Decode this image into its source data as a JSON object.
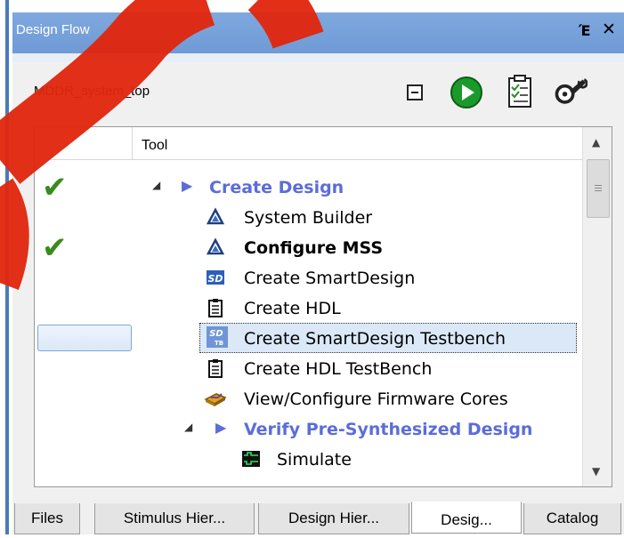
{
  "window": {
    "title": "Design Flow",
    "float_glyph": "Έ",
    "close_glyph": "✕"
  },
  "toolbar": {
    "design_name": "MDDR_system_top",
    "icons": [
      "collapse-icon",
      "run-icon",
      "report-icon",
      "settings-wrench-icon"
    ]
  },
  "tree": {
    "column_header": "Tool",
    "rows": [
      {
        "label": "Create Design",
        "kind": "group",
        "checked": true,
        "expanded": true,
        "icon": "expand-arrow"
      },
      {
        "label": "System Builder",
        "kind": "item",
        "checked": false,
        "icon": "system-builder-icon"
      },
      {
        "label": "Configure MSS",
        "kind": "item-bold",
        "checked": true,
        "icon": "system-builder-icon"
      },
      {
        "label": "Create SmartDesign",
        "kind": "item",
        "checked": false,
        "icon": "smartdesign-icon",
        "icon_text": "SD"
      },
      {
        "label": "Create HDL",
        "kind": "item",
        "checked": false,
        "icon": "hdl-document-icon"
      },
      {
        "label": "Create SmartDesign Testbench",
        "kind": "item",
        "checked": false,
        "selected": true,
        "icon": "smartdesign-testbench-icon",
        "icon_text": "SD",
        "icon_subtext": "TB"
      },
      {
        "label": "Create HDL TestBench",
        "kind": "item",
        "checked": false,
        "icon": "hdl-document-icon"
      },
      {
        "label": "View/Configure Firmware Cores",
        "kind": "item",
        "checked": false,
        "icon": "firmware-icon"
      },
      {
        "label": "Verify Pre-Synthesized Design",
        "kind": "group",
        "checked": false,
        "expanded": true,
        "icon": "expand-arrow"
      },
      {
        "label": "Simulate",
        "kind": "item",
        "checked": false,
        "icon": "simulate-icon"
      }
    ]
  },
  "tabs": [
    {
      "label": "Files",
      "active": false
    },
    {
      "label": "Stimulus Hier...",
      "active": false
    },
    {
      "label": "Design Hier...",
      "active": false
    },
    {
      "label": "Desig...",
      "active": true
    },
    {
      "label": "Catalog",
      "active": false
    }
  ],
  "colors": {
    "accent": "#6f9ad6",
    "group_text": "#5b6dd9",
    "check": "#3a8a1e",
    "watermark": "#e0260f"
  }
}
